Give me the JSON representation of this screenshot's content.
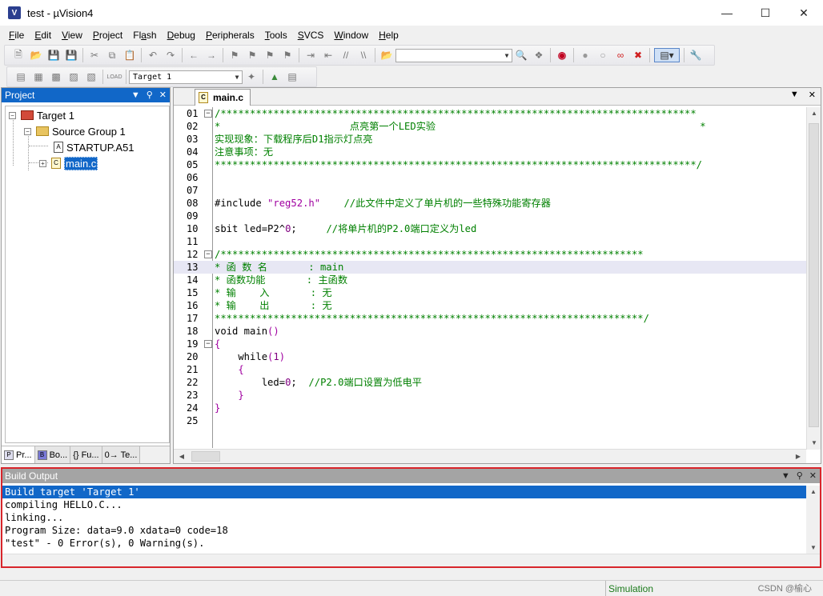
{
  "window": {
    "title": "test  - µVision4",
    "icon": "uvision-app-icon"
  },
  "menubar": [
    {
      "label": "File",
      "key": "F"
    },
    {
      "label": "Edit",
      "key": "E"
    },
    {
      "label": "View",
      "key": "V"
    },
    {
      "label": "Project",
      "key": "P"
    },
    {
      "label": "Flash",
      "key": "a"
    },
    {
      "label": "Debug",
      "key": "D"
    },
    {
      "label": "Peripherals",
      "key": "P"
    },
    {
      "label": "Tools",
      "key": "T"
    },
    {
      "label": "SVCS",
      "key": "S"
    },
    {
      "label": "Window",
      "key": "W"
    },
    {
      "label": "Help",
      "key": "H"
    }
  ],
  "toolbar2": {
    "target_select": "Target 1"
  },
  "project": {
    "title": "Project",
    "tree": {
      "target": "Target 1",
      "group": "Source Group 1",
      "files": [
        "STARTUP.A51",
        "main.c"
      ]
    },
    "tabs": [
      "Pr...",
      "Bo...",
      "{} Fu...",
      "0→ Te..."
    ]
  },
  "editor": {
    "tab_label": "main.c",
    "current_line": 13,
    "lines": [
      {
        "n": "01",
        "fold": "-",
        "segs": [
          [
            "c-comment",
            "/*********************************************************************************"
          ]
        ]
      },
      {
        "n": "02",
        "segs": [
          [
            "c-comment",
            "*                      点亮第一个LED实验                                             *"
          ]
        ]
      },
      {
        "n": "03",
        "segs": [
          [
            "c-comment",
            "实现现象：下载程序后D1指示灯点亮"
          ]
        ]
      },
      {
        "n": "04",
        "segs": [
          [
            "c-comment",
            "注意事项：无"
          ]
        ]
      },
      {
        "n": "05",
        "segs": [
          [
            "c-comment",
            "**********************************************************************************/"
          ]
        ]
      },
      {
        "n": "06",
        "segs": []
      },
      {
        "n": "07",
        "segs": []
      },
      {
        "n": "08",
        "segs": [
          [
            "c-plain",
            "#include "
          ],
          [
            "c-string",
            "\"reg52.h\""
          ],
          [
            "c-plain",
            "    "
          ],
          [
            "c-comment",
            "//此文件中定义了单片机的一些特殊功能寄存器"
          ]
        ]
      },
      {
        "n": "09",
        "segs": []
      },
      {
        "n": "10",
        "segs": [
          [
            "c-plain",
            "sbit led=P2^"
          ],
          [
            "c-number",
            "0"
          ],
          [
            "c-plain",
            ";     "
          ],
          [
            "c-comment",
            "//将单片机的P2.0端口定义为led"
          ]
        ]
      },
      {
        "n": "11",
        "segs": []
      },
      {
        "n": "12",
        "fold": "-",
        "segs": [
          [
            "c-comment",
            "/************************************************************************"
          ]
        ]
      },
      {
        "n": "13",
        "segs": [
          [
            "c-comment",
            "* 函 数 名       : main"
          ]
        ]
      },
      {
        "n": "14",
        "segs": [
          [
            "c-comment",
            "* 函数功能       : 主函数"
          ]
        ]
      },
      {
        "n": "15",
        "segs": [
          [
            "c-comment",
            "* 输    入       : 无"
          ]
        ]
      },
      {
        "n": "16",
        "segs": [
          [
            "c-comment",
            "* 输    出       : 无"
          ]
        ]
      },
      {
        "n": "17",
        "segs": [
          [
            "c-comment",
            "*************************************************************************/"
          ]
        ]
      },
      {
        "n": "18",
        "segs": [
          [
            "c-plain",
            "void main"
          ],
          [
            "c-paren",
            "()"
          ]
        ]
      },
      {
        "n": "19",
        "fold": "-",
        "segs": [
          [
            "c-paren",
            "{"
          ]
        ]
      },
      {
        "n": "20",
        "segs": [
          [
            "c-plain",
            "    while"
          ],
          [
            "c-paren",
            "("
          ],
          [
            "c-number",
            "1"
          ],
          [
            "c-paren",
            ")"
          ]
        ]
      },
      {
        "n": "21",
        "segs": [
          [
            "c-paren",
            "    {"
          ]
        ]
      },
      {
        "n": "22",
        "segs": [
          [
            "c-plain",
            "        led="
          ],
          [
            "c-number",
            "0"
          ],
          [
            "c-plain",
            ";  "
          ],
          [
            "c-comment",
            "//P2.0端口设置为低电平"
          ]
        ]
      },
      {
        "n": "23",
        "segs": [
          [
            "c-paren",
            "    }"
          ]
        ]
      },
      {
        "n": "24",
        "segs": [
          [
            "c-paren",
            "}"
          ]
        ]
      },
      {
        "n": "25",
        "segs": []
      }
    ]
  },
  "build": {
    "title": "Build Output",
    "lines": [
      "Build target 'Target 1'",
      "compiling HELLO.C...",
      "linking...",
      "Program Size: data=9.0 xdata=0 code=18",
      "\"test\" - 0 Error(s), 0 Warning(s)."
    ]
  },
  "status": {
    "mode": "Simulation",
    "watermark": "CSDN @榆心"
  }
}
